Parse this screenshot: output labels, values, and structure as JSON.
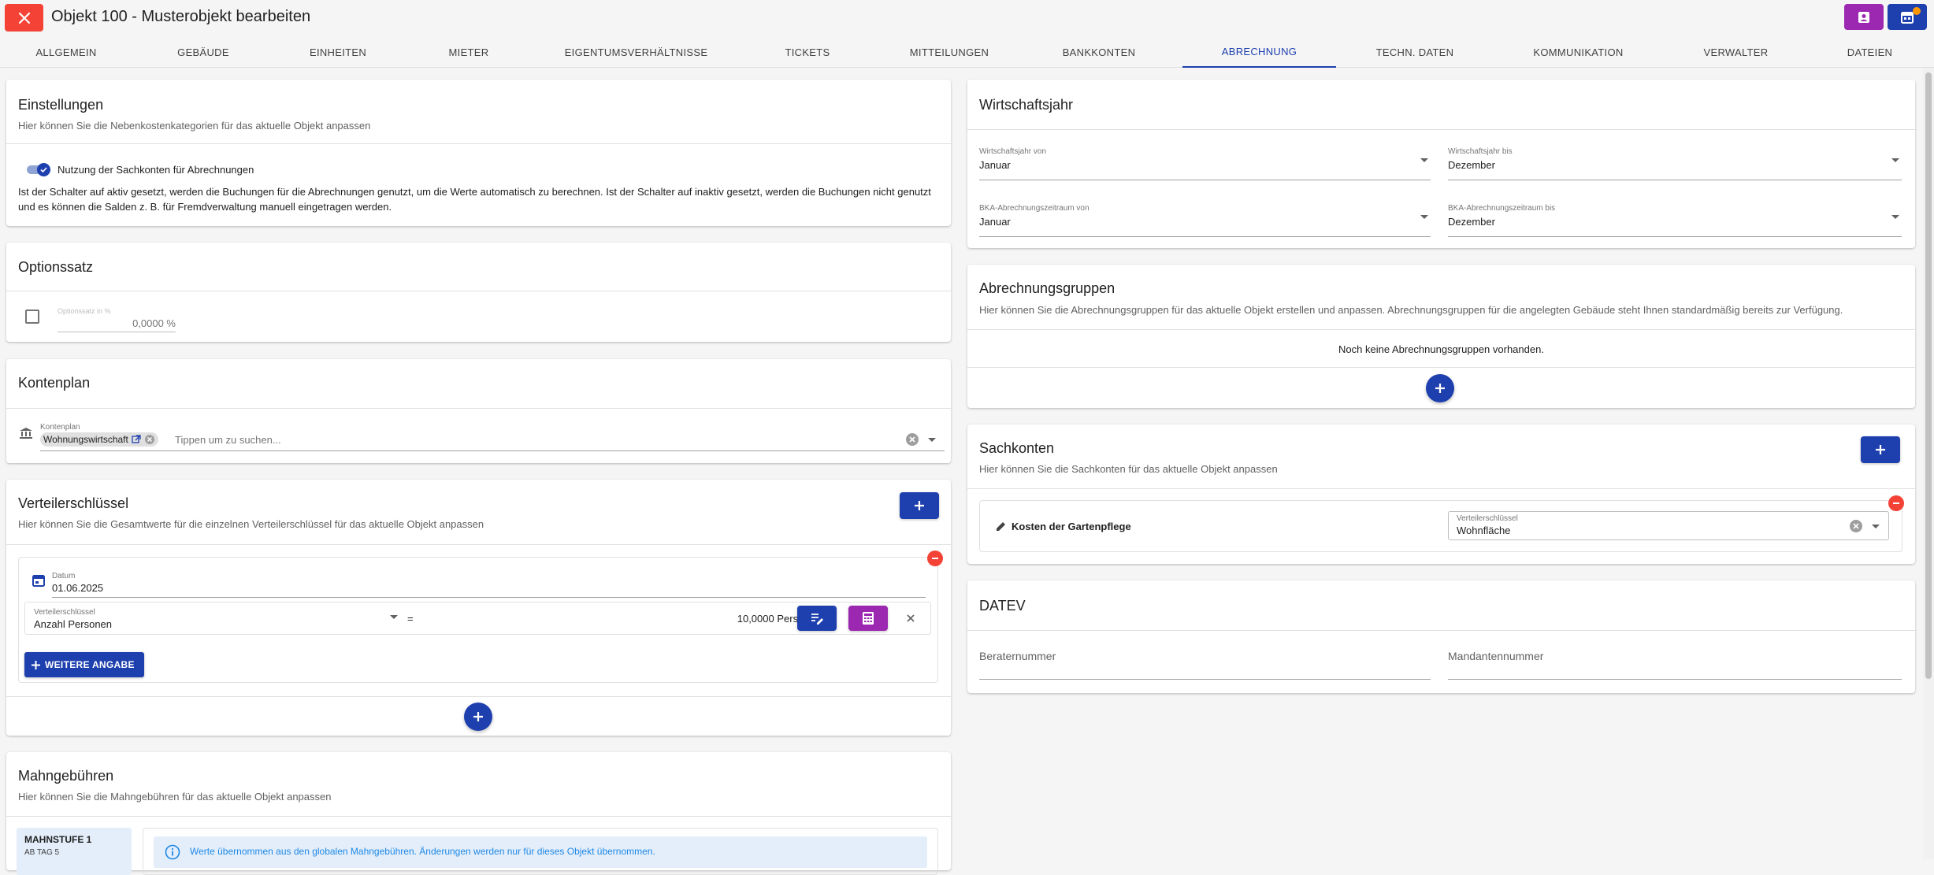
{
  "header": {
    "title": "Objekt 100 - Musterobjekt bearbeiten",
    "close_icon": "close-icon",
    "right_buttons": [
      {
        "icon": "contact-icon",
        "color": "#9c27b0"
      },
      {
        "icon": "calendar-icon",
        "color": "#1e40af"
      }
    ]
  },
  "tabs": [
    {
      "label": "ALLGEMEIN"
    },
    {
      "label": "GEBÄUDE"
    },
    {
      "label": "EINHEITEN"
    },
    {
      "label": "MIETER"
    },
    {
      "label": "EIGENTUMSVERHÄLTNISSE"
    },
    {
      "label": "TICKETS"
    },
    {
      "label": "MITTEILUNGEN"
    },
    {
      "label": "BANKKONTEN"
    },
    {
      "label": "ABRECHNUNG",
      "active": true
    },
    {
      "label": "TECHN. DATEN"
    },
    {
      "label": "KOMMUNIKATION"
    },
    {
      "label": "VERWALTER"
    },
    {
      "label": "DATEIEN"
    }
  ],
  "einstellungen": {
    "title": "Einstellungen",
    "subtitle": "Hier können Sie die Nebenkostenkategorien für das aktuelle Objekt anpassen",
    "toggle_label": "Nutzung der Sachkonten für Abrechnungen",
    "description": "Ist der Schalter auf aktiv gesetzt, werden die Buchungen für die Abrechnungen genutzt, um die Werte automatisch zu berechnen. Ist der Schalter auf inaktiv gesetzt, werden die Buchungen nicht genutzt und es können die Salden z. B. für Fremdverwaltung manuell eingetragen werden."
  },
  "optionssatz": {
    "title": "Optionssatz",
    "field_label": "Optionssatz in %",
    "field_value": "0,0000 %"
  },
  "kontenplan": {
    "title": "Kontenplan",
    "field_label": "Kontenplan",
    "chip": "Wohnungswirtschaft",
    "placeholder": "Tippen um zu suchen..."
  },
  "verteilerschluessel": {
    "title": "Verteilerschlüssel",
    "subtitle": "Hier können Sie die Gesamtwerte für die einzelnen Verteilerschlüssel für das aktuelle Objekt anpassen",
    "date_label": "Datum",
    "date_value": "01.06.2025",
    "key_label": "Verteilerschlüssel",
    "key_value": "Anzahl Personen",
    "equals": "=",
    "amount": "10,0000 Personen",
    "more_button": "WEITERE ANGABE"
  },
  "mahngebuehren": {
    "title": "Mahngebühren",
    "subtitle": "Hier können Sie die Mahngebühren für das aktuelle Objekt anpassen",
    "level_title": "MAHNSTUFE 1",
    "level_sub": "AB TAG 5",
    "info_text": "Werte übernommen aus den globalen Mahngebühren. Änderungen werden nur für dieses Objekt übernommen."
  },
  "wirtschaftsjahr": {
    "title": "Wirtschaftsjahr",
    "from_label": "Wirtschaftsjahr von",
    "from_value": "Januar",
    "to_label": "Wirtschaftsjahr bis",
    "to_value": "Dezember",
    "bka_from_label": "BKA-Abrechnungszeitraum von",
    "bka_from_value": "Januar",
    "bka_to_label": "BKA-Abrechnungszeitraum bis",
    "bka_to_value": "Dezember"
  },
  "abrechnungsgruppen": {
    "title": "Abrechnungsgruppen",
    "subtitle": "Hier können Sie die Abrechnungsgruppen für das aktuelle Objekt erstellen und anpassen. Abrechnungsgruppen für die angelegten Gebäude steht Ihnen standardmäßig bereits zur Verfügung.",
    "empty": "Noch keine Abrechnungsgruppen vorhanden."
  },
  "sachkonten": {
    "title": "Sachkonten",
    "subtitle": "Hier können Sie die Sachkonten für das aktuelle Objekt anpassen",
    "item_name": "Kosten der Gartenpflege",
    "key_label": "Verteilerschlüssel",
    "key_value": "Wohnfläche"
  },
  "datev": {
    "title": "DATEV",
    "berater": "Beraternummer",
    "mandant": "Mandantennummer"
  },
  "colors": {
    "accent": "#1e40af",
    "purple": "#9c27b0",
    "danger": "#f44336"
  }
}
